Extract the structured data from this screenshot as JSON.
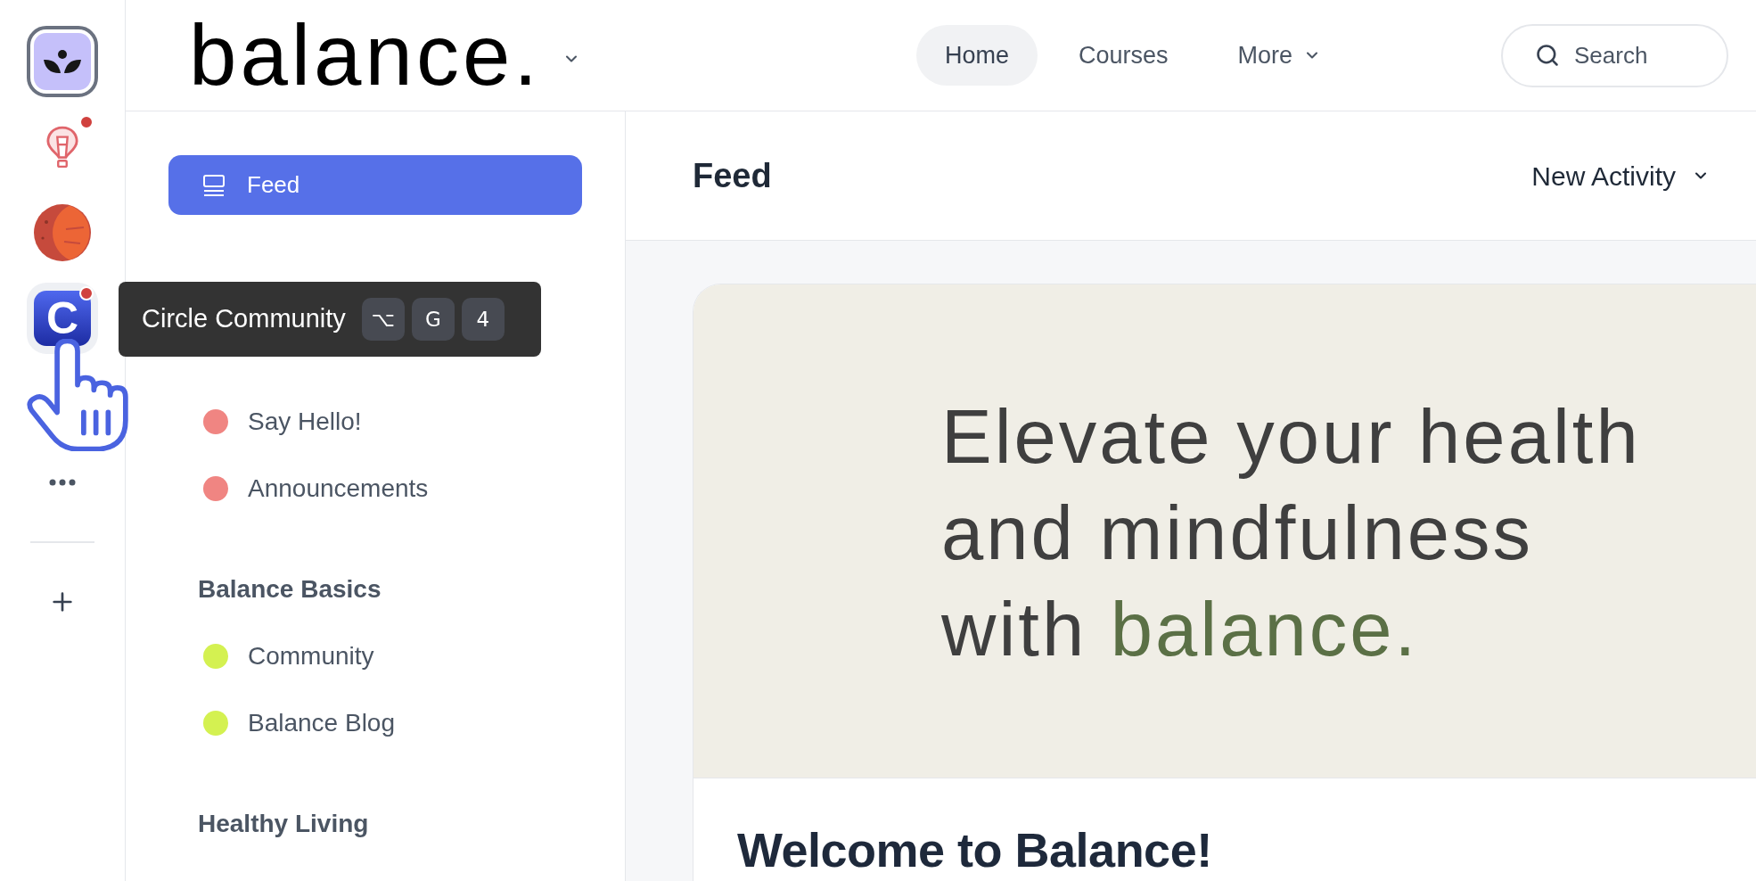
{
  "rail": {
    "items": [
      {
        "kind": "lotus",
        "selected": true,
        "hovered": false,
        "unread": false
      },
      {
        "kind": "balloon",
        "selected": false,
        "hovered": false,
        "unread": true
      },
      {
        "kind": "planet",
        "selected": false,
        "hovered": false,
        "unread": false
      },
      {
        "kind": "letter",
        "letter": "C",
        "selected": false,
        "hovered": true,
        "unread": true
      }
    ]
  },
  "tooltip": {
    "label": "Circle Community",
    "keys": [
      "⌥",
      "G",
      "4"
    ]
  },
  "header": {
    "brand": "balance.",
    "nav": [
      {
        "label": "Home",
        "selected": true,
        "dropdown": false
      },
      {
        "label": "Courses",
        "selected": false,
        "dropdown": false
      },
      {
        "label": "More",
        "selected": false,
        "dropdown": true
      }
    ],
    "search": {
      "placeholder": "Search"
    }
  },
  "sidebar": {
    "feed": {
      "label": "Feed",
      "selected": true
    },
    "groups": [
      {
        "items": [
          {
            "label": "Say Hello!",
            "color": "#f08582"
          },
          {
            "label": "Announcements",
            "color": "#f08582"
          }
        ]
      },
      {
        "heading": "Balance Basics",
        "items": [
          {
            "label": "Community",
            "color": "#d4f151"
          },
          {
            "label": "Balance Blog",
            "color": "#d4f151"
          }
        ]
      },
      {
        "heading": "Healthy Living"
      }
    ]
  },
  "main": {
    "title": "Feed",
    "filter": "New Activity",
    "hero": {
      "segments": [
        {
          "text": "Elevate your health and mindfulness with ",
          "accent": false
        },
        {
          "text": "balance.",
          "accent": true
        }
      ]
    },
    "post": {
      "title": "Welcome to Balance!"
    }
  }
}
